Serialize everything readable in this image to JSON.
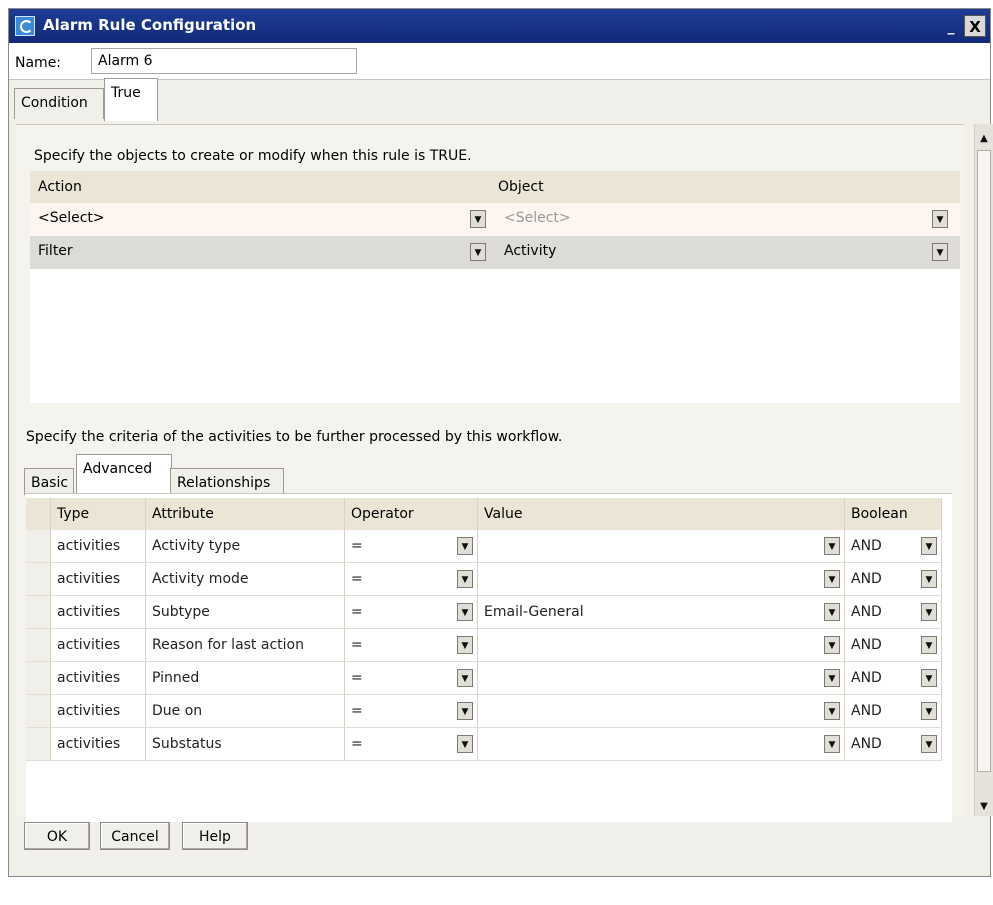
{
  "window": {
    "title": "Alarm Rule Configuration",
    "minimize": "_",
    "close": "X"
  },
  "name_field": {
    "label": "Name:",
    "value": "Alarm 6"
  },
  "tabs_top": [
    {
      "label": "Condition",
      "active": false
    },
    {
      "label": "True",
      "active": true
    }
  ],
  "true_panel": {
    "instruction": "Specify the objects to create or modify when this rule is TRUE.",
    "columns": {
      "action": "Action",
      "object": "Object"
    },
    "rows": [
      {
        "action": "<Select>",
        "object": "<Select>"
      },
      {
        "action": "Filter",
        "object": "Activity"
      }
    ]
  },
  "criteria": {
    "instruction": "Specify the criteria of the activities to be further processed by this workflow.",
    "tabs": [
      {
        "label": "Basic",
        "active": false
      },
      {
        "label": "Advanced",
        "active": true
      },
      {
        "label": "Relationships",
        "active": false
      }
    ],
    "columns": [
      "Type",
      "Attribute",
      "Operator",
      "Value",
      "Boolean"
    ],
    "rows": [
      {
        "type": "activities",
        "attribute": "Activity type",
        "operator": "=",
        "value": "",
        "boolean": "AND"
      },
      {
        "type": "activities",
        "attribute": "Activity mode",
        "operator": "=",
        "value": "",
        "boolean": "AND"
      },
      {
        "type": "activities",
        "attribute": "Subtype",
        "operator": "=",
        "value": "Email-General",
        "boolean": "AND"
      },
      {
        "type": "activities",
        "attribute": "Reason for last action",
        "operator": "=",
        "value": "",
        "boolean": "AND"
      },
      {
        "type": "activities",
        "attribute": "Pinned",
        "operator": "=",
        "value": "",
        "boolean": "AND"
      },
      {
        "type": "activities",
        "attribute": "Due on",
        "operator": "=",
        "value": "",
        "boolean": "AND"
      },
      {
        "type": "activities",
        "attribute": "Substatus",
        "operator": "=",
        "value": "",
        "boolean": "AND"
      }
    ]
  },
  "buttons": {
    "ok": "OK",
    "cancel": "Cancel",
    "help": "Help"
  },
  "colors": {
    "titlebar": "#1d3d93",
    "grid_header": "#ebe5d6",
    "select_row": "#fdf6f0",
    "filter_row": "#dcdbd8"
  }
}
